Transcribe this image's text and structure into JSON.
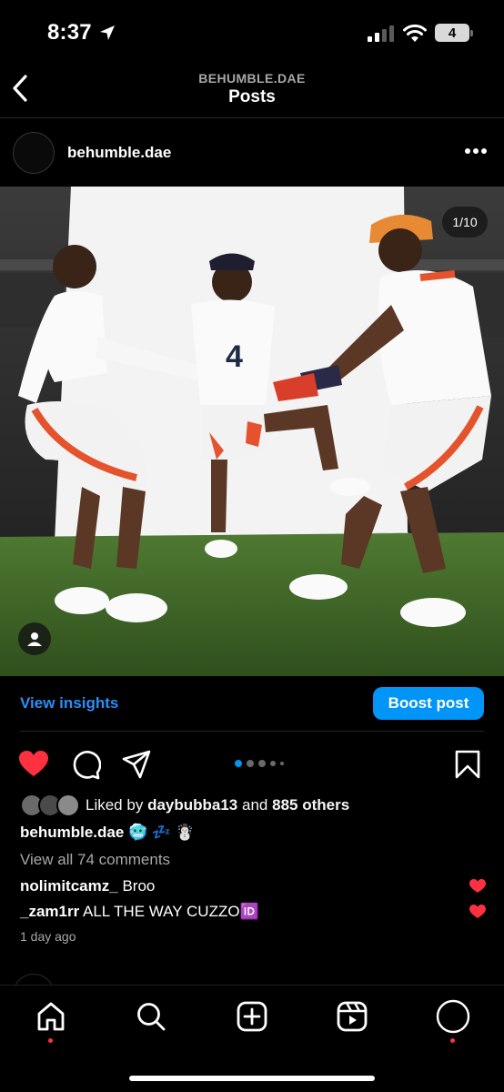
{
  "status_bar": {
    "time": "8:37",
    "battery": "4"
  },
  "header": {
    "username": "BEHUMBLE.DAE",
    "title": "Posts"
  },
  "post": {
    "username": "behumble.dae",
    "image_counter": "1/10",
    "view_insights": "View insights",
    "boost_post": "Boost post",
    "liked_by_prefix": "Liked by",
    "liked_by_user": "daybubba13",
    "liked_by_and": "and",
    "liked_by_others": "885 others",
    "caption_user": "behumble.dae",
    "caption_text": "🥶 💤 ☃️",
    "view_comments": "View all 74 comments",
    "comments": [
      {
        "user": "nolimitcamz_",
        "text": "Broo"
      },
      {
        "user": "_zam1rr",
        "text": "ALL THE WAY CUZZO🆔"
      }
    ],
    "timestamp": "1 day ago"
  },
  "colors": {
    "like_red": "#ff3040",
    "link_blue": "#2c8ef8",
    "boost_blue": "#0095f6",
    "dot_active": "#0095f6"
  },
  "icons": [
    "location-arrow-icon",
    "signal-icon",
    "wifi-icon",
    "back-icon",
    "more-icon",
    "tag-user-icon",
    "heart-icon",
    "comment-icon",
    "share-icon",
    "bookmark-icon",
    "home-icon",
    "search-icon",
    "create-icon",
    "reels-icon",
    "profile-icon"
  ]
}
